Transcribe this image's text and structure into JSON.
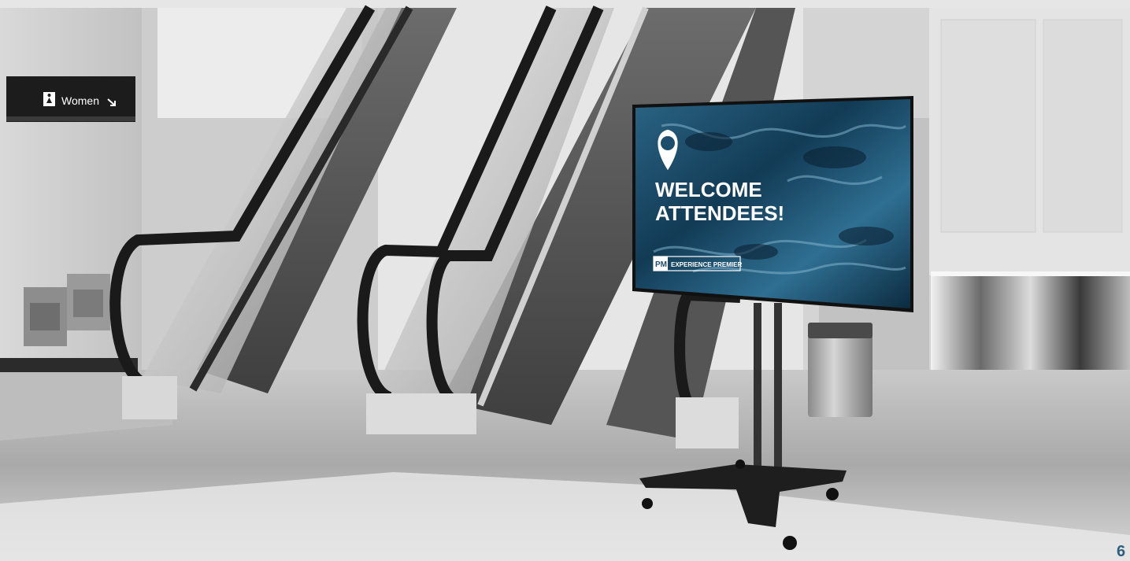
{
  "restroom_sign": {
    "label": "Women",
    "person_icon": "woman-icon",
    "arrow_icon": "arrow-down-right-icon"
  },
  "display": {
    "pin_icon": "map-pin-icon",
    "headline_line1": "WELCOME",
    "headline_line2": "ATTENDEES!",
    "logo_mark": "PM",
    "logo_text": "EXPERIENCE PREMIER",
    "accent_color": "#1d4f6c"
  },
  "page_number": "6"
}
